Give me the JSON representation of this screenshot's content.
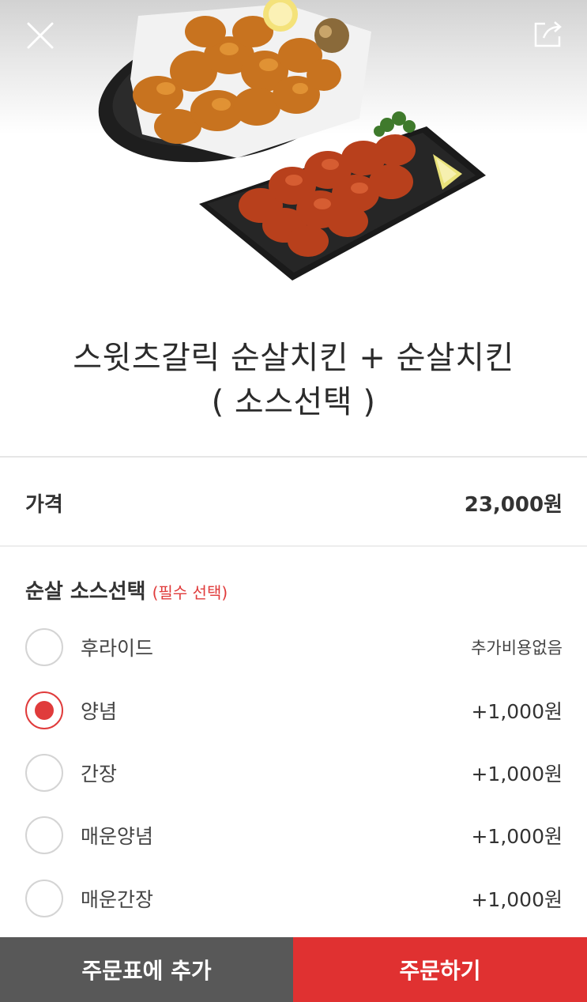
{
  "header": {
    "close_icon": "close-icon",
    "share_icon": "share-icon"
  },
  "product": {
    "image": "chicken-dishes-image",
    "title_line1": "스윗츠갈릭 순살치킨 + 순살치킨",
    "title_line2": "( 소스선택 )",
    "price_label": "가격",
    "price_value": "23,000원"
  },
  "sauce_section": {
    "title": "순살 소스선택",
    "required_note": "(필수 선택)",
    "options": [
      {
        "label": "후라이드",
        "price": "추가비용없음",
        "checked": false
      },
      {
        "label": "양념",
        "price": "+1,000원",
        "checked": true
      },
      {
        "label": "간장",
        "price": "+1,000원",
        "checked": false
      },
      {
        "label": "매운양념",
        "price": "+1,000원",
        "checked": false
      },
      {
        "label": "매운간장",
        "price": "+1,000원",
        "checked": false
      }
    ]
  },
  "footer": {
    "add_to_cart_label": "주문표에 추가",
    "order_label": "주문하기"
  },
  "colors": {
    "accent": "#e03131",
    "dark_button": "#585858",
    "text": "#333333"
  }
}
